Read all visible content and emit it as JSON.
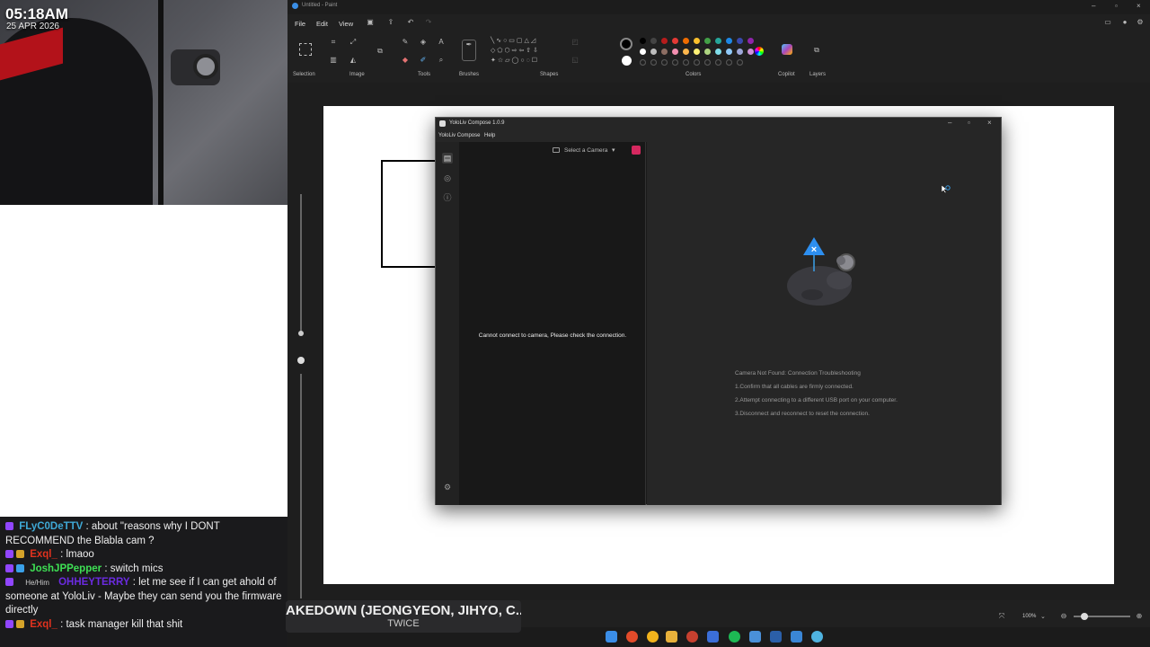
{
  "overlay": {
    "clock": "05:18AM",
    "date": "25 APR 2026",
    "chat": [
      {
        "user": "FLyC0DeTTV",
        "text": ": about \"reasons why I DONT RECOMMEND the Blabla cam ?"
      },
      {
        "user": "Exql_",
        "text": ": lmaoo"
      },
      {
        "user": "JoshJPPepper",
        "text": ": switch mics"
      },
      {
        "pronoun": "He/Him",
        "user": "OHHEYTERRY",
        "text": ": let me see if I can get ahold of someone at YoloLiv - Maybe they can send you the firmware directly"
      },
      {
        "user": "Exql_",
        "text": ": task manager kill that shit"
      }
    ],
    "now_playing": {
      "title": "AKEDOWN (JEONGYEON, JIHYO, C...",
      "artist": "TWICE"
    }
  },
  "paint": {
    "window_title": "Untitled - Paint",
    "menu": [
      "File",
      "Edit",
      "View"
    ],
    "groups": [
      "Selection",
      "Image",
      "Tools",
      "Brushes",
      "Shapes",
      "Colors",
      "Copilot",
      "Layers"
    ],
    "zoom": "100%",
    "colors": {
      "row1": [
        "#000000",
        "#444444",
        "#b71c1c",
        "#e53935",
        "#ef6c00",
        "#fbc02d",
        "#43a047",
        "#26a69a",
        "#1e88e5",
        "#3949ab",
        "#8e24aa"
      ],
      "row2": [
        "#ffffff",
        "#bdbdbd",
        "#8d6e63",
        "#f48fb1",
        "#ffb74d",
        "#fff176",
        "#aed581",
        "#80deea",
        "#90caf9",
        "#9fa8da",
        "#ce93d8"
      ]
    }
  },
  "yololiv": {
    "title": "YoloLiv Compose  1.0.9",
    "menu": [
      "YoloLiv Compose",
      "Help"
    ],
    "select_camera": "Select a Camera",
    "no_camera_message": "Cannot connect to camera, Please check the connection.",
    "troubleshoot": {
      "heading": "Camera Not Found: Connection Troubleshooting",
      "steps": [
        "1.Confirm that all cables are firmly connected.",
        "2.Attempt connecting to a different USB port on your computer.",
        "3.Disconnect and reconnect to reset the connection."
      ]
    }
  }
}
